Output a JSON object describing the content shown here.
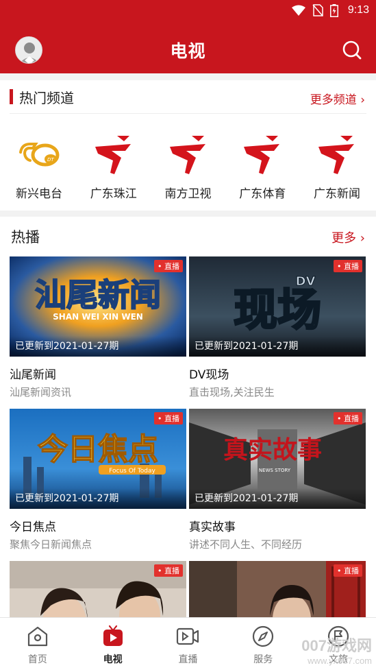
{
  "status": {
    "time": "9:13"
  },
  "header": {
    "title": "电视"
  },
  "channels": {
    "title": "热门频道",
    "more": "更多频道 ›",
    "items": [
      {
        "name": "新兴电台",
        "logo": "xinxing-radio-logo"
      },
      {
        "name": "广东珠江",
        "logo": "guangdong-tv-logo"
      },
      {
        "name": "南方卫视",
        "logo": "guangdong-tv-logo"
      },
      {
        "name": "广东体育",
        "logo": "guangdong-tv-logo"
      },
      {
        "name": "广东新闻",
        "logo": "guangdong-tv-logo"
      }
    ]
  },
  "hot": {
    "title": "热播",
    "more": "更多 ›",
    "live_label": "• 直播",
    "cards": [
      {
        "title": "汕尾新闻",
        "subtitle": "汕尾新闻资讯",
        "updated": "已更新到2021-01-27期",
        "thumb_text": "汕尾新闻",
        "thumb_sub": "SHAN WEI XIN WEN"
      },
      {
        "title": "DV现场",
        "subtitle": "直击现场,关注民生",
        "updated": "已更新到2021-01-27期",
        "thumb_text": "现场",
        "thumb_sub": "DV"
      },
      {
        "title": "今日焦点",
        "subtitle": "聚焦今日新闻焦点",
        "updated": "已更新到2021-01-27期",
        "thumb_text": "今日焦点",
        "thumb_sub": "Focus Of Today"
      },
      {
        "title": "真实故事",
        "subtitle": "讲述不同人生、不同经历",
        "updated": "已更新到2021-01-27期",
        "thumb_text": "真实故事",
        "thumb_sub": "NEWS STORY"
      },
      {
        "title": "",
        "subtitle": "",
        "updated": "",
        "thumb_text": "",
        "thumb_sub": ""
      },
      {
        "title": "",
        "subtitle": "",
        "updated": "",
        "thumb_text": "",
        "thumb_sub": ""
      }
    ]
  },
  "bottom_nav": [
    {
      "label": "首页",
      "icon": "home-icon",
      "active": false
    },
    {
      "label": "电视",
      "icon": "tv-icon",
      "active": true
    },
    {
      "label": "直播",
      "icon": "live-video-icon",
      "active": false
    },
    {
      "label": "服务",
      "icon": "compass-icon",
      "active": false
    },
    {
      "label": "文旅",
      "icon": "flag-icon",
      "active": false
    }
  ],
  "watermark": {
    "text": "007游戏网",
    "sub": "www.yx007.com"
  },
  "colors": {
    "brand": "#c8161e",
    "live_tag": "#e2312d"
  }
}
